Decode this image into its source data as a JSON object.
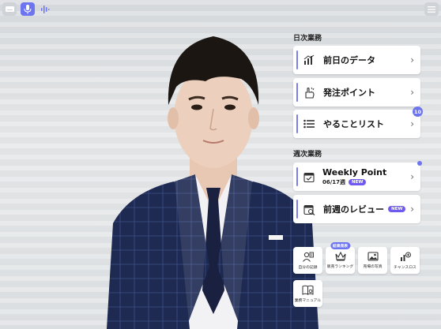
{
  "daily": {
    "title": "日次業務",
    "items": [
      {
        "label": "前日のデータ",
        "icon": "bar-chart-icon"
      },
      {
        "label": "発注ポイント",
        "icon": "hand-point-icon"
      },
      {
        "label": "やることリスト",
        "icon": "list-icon",
        "count": "10"
      }
    ]
  },
  "weekly": {
    "title": "週次業務",
    "weekly_point": {
      "label": "Weekly Point",
      "sub": "06/17週",
      "badge": "NEW",
      "icon": "calendar-check-icon"
    },
    "review": {
      "label": "前週のレビュー",
      "badge": "NEW",
      "icon": "calendar-search-icon"
    }
  },
  "tiles": [
    {
      "label": "自分の記録",
      "icon": "person-record-icon"
    },
    {
      "label": "販売ランキング",
      "icon": "crown-icon",
      "badge": "結果発表"
    },
    {
      "label": "売場の写真",
      "icon": "photo-icon"
    },
    {
      "label": "チャンスロス",
      "icon": "chance-loss-icon"
    },
    {
      "label": "業務マニュアル",
      "icon": "book-icon"
    }
  ],
  "colors": {
    "accent": "#6d74f0",
    "badge": "#6e5af0"
  }
}
